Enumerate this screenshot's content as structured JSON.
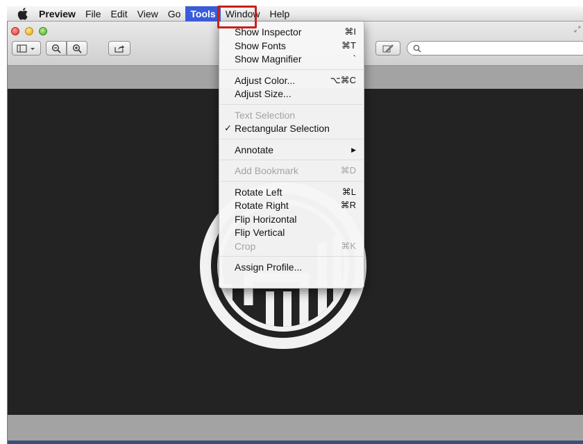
{
  "menubar": {
    "app_name": "Preview",
    "items": [
      "File",
      "Edit",
      "View",
      "Go",
      "Tools",
      "Window",
      "Help"
    ],
    "active_item": "Tools"
  },
  "toolbar": {
    "search_placeholder": ""
  },
  "tools_menu": {
    "groups": [
      [
        {
          "label": "Show Inspector",
          "shortcut": "⌘I",
          "enabled": true
        },
        {
          "label": "Show Fonts",
          "shortcut": "⌘T",
          "enabled": true
        },
        {
          "label": "Show Magnifier",
          "shortcut": "`",
          "enabled": true
        }
      ],
      [
        {
          "label": "Adjust Color...",
          "shortcut": "⌥⌘C",
          "enabled": true
        },
        {
          "label": "Adjust Size...",
          "shortcut": "",
          "enabled": true
        }
      ],
      [
        {
          "label": "Text Selection",
          "shortcut": "",
          "enabled": false
        },
        {
          "label": "Rectangular Selection",
          "shortcut": "",
          "enabled": true,
          "checked": true
        }
      ],
      [
        {
          "label": "Annotate",
          "shortcut": "",
          "enabled": true,
          "submenu": true
        }
      ],
      [
        {
          "label": "Add Bookmark",
          "shortcut": "⌘D",
          "enabled": false
        }
      ],
      [
        {
          "label": "Rotate Left",
          "shortcut": "⌘L",
          "enabled": true
        },
        {
          "label": "Rotate Right",
          "shortcut": "⌘R",
          "enabled": true
        },
        {
          "label": "Flip Horizontal",
          "shortcut": "",
          "enabled": true
        },
        {
          "label": "Flip Vertical",
          "shortcut": "",
          "enabled": true
        },
        {
          "label": "Crop",
          "shortcut": "⌘K",
          "enabled": false
        }
      ],
      [
        {
          "label": "Assign Profile...",
          "shortcut": "",
          "enabled": true
        }
      ]
    ]
  },
  "colors": {
    "menu_highlight": "#3b5bd8",
    "annotation_box": "#c8201b",
    "canvas_bg": "#232323"
  }
}
